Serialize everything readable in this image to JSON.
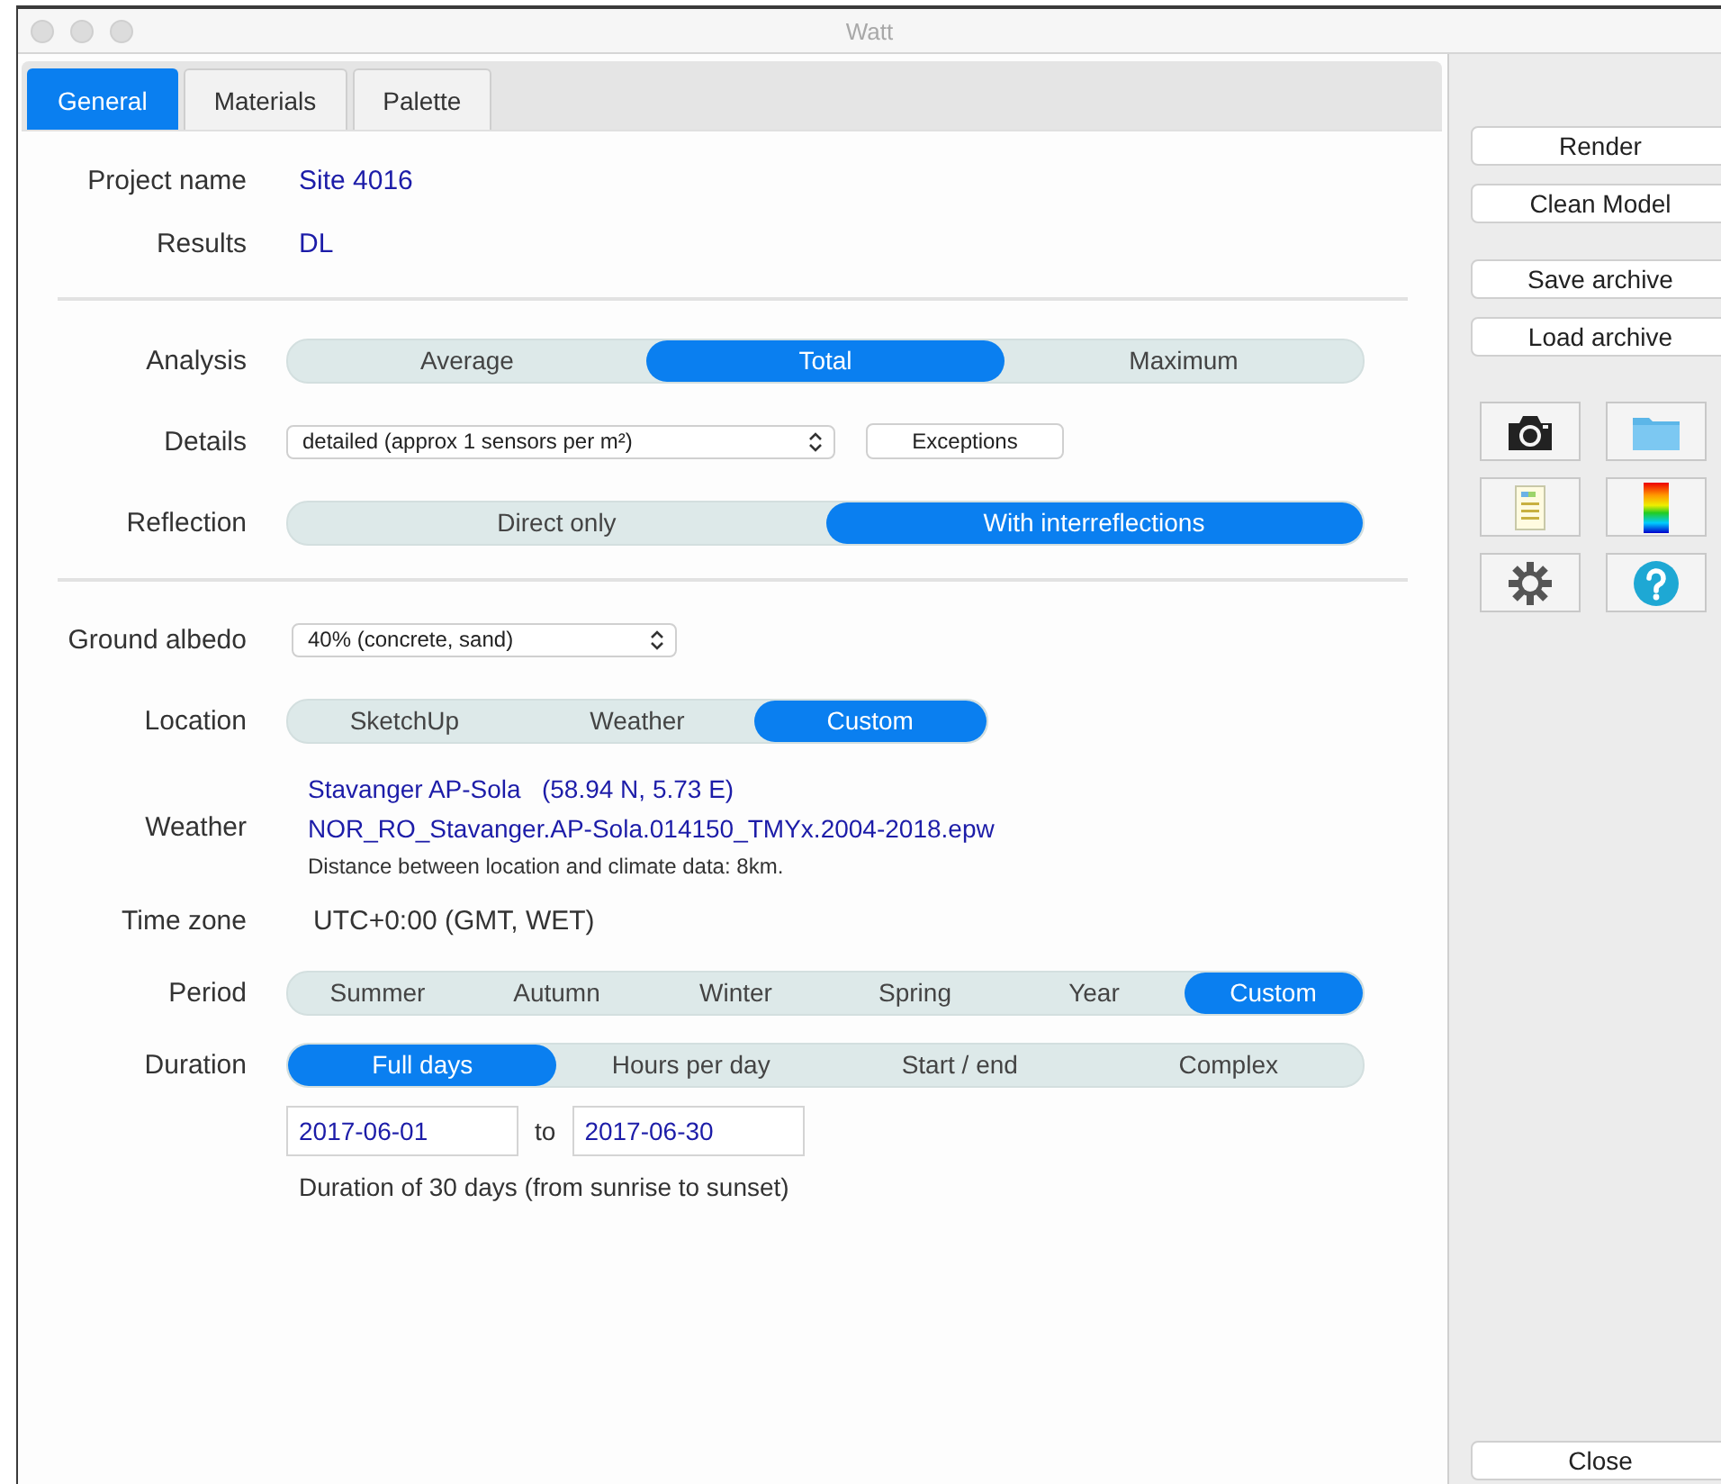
{
  "window": {
    "title": "Watt"
  },
  "tabs": [
    {
      "label": "General",
      "selected": true
    },
    {
      "label": "Materials",
      "selected": false
    },
    {
      "label": "Palette",
      "selected": false
    }
  ],
  "sections": [
    [
      {
        "kind": "value",
        "label": "Project name",
        "value": "Site 4016"
      },
      {
        "kind": "value",
        "label": "Results",
        "value": "DL"
      }
    ],
    [
      {
        "kind": "segmented",
        "label": "Analysis",
        "options": [
          {
            "label": "Average",
            "selected": false
          },
          {
            "label": "Total",
            "selected": true
          },
          {
            "label": "Maximum",
            "selected": false
          }
        ]
      },
      {
        "kind": "select",
        "label": "Details",
        "value": "detailed (approx 1 sensors per m²)",
        "button": "Exceptions"
      },
      {
        "kind": "segmented",
        "label": "Reflection",
        "options": [
          {
            "label": "Direct only",
            "selected": false
          },
          {
            "label": "With interreflections",
            "selected": true
          }
        ]
      }
    ],
    [
      {
        "kind": "select",
        "label": "Ground albedo",
        "value": "40% (concrete, sand)"
      },
      {
        "kind": "segmented",
        "label": "Location",
        "compact": true,
        "options": [
          {
            "label": "SketchUp",
            "selected": false
          },
          {
            "label": "Weather",
            "selected": false
          },
          {
            "label": "Custom",
            "selected": true
          }
        ]
      },
      {
        "kind": "weather",
        "label": "Weather",
        "station": "Stavanger AP-Sola",
        "coords": "(58.94 N, 5.73 E)",
        "file": "NOR_RO_Stavanger.AP-Sola.014150_TMYx.2004-2018.epw",
        "note": "Distance between location and climate data: 8km."
      },
      {
        "kind": "text",
        "label": "Time zone",
        "value": "UTC+0:00 (GMT, WET)"
      },
      {
        "kind": "segmented",
        "label": "Period",
        "options": [
          {
            "label": "Summer",
            "selected": false
          },
          {
            "label": "Autumn",
            "selected": false
          },
          {
            "label": "Winter",
            "selected": false
          },
          {
            "label": "Spring",
            "selected": false
          },
          {
            "label": "Year",
            "selected": false
          },
          {
            "label": "Custom",
            "selected": true
          }
        ]
      },
      {
        "kind": "segmented",
        "label": "Duration",
        "tight": true,
        "options": [
          {
            "label": "Full days",
            "selected": true
          },
          {
            "label": "Hours per day",
            "selected": false
          },
          {
            "label": "Start / end",
            "selected": false
          },
          {
            "label": "Complex",
            "selected": false
          }
        ]
      },
      {
        "kind": "dates",
        "from": "2017-06-01",
        "joiner": "to",
        "to": "2017-06-30",
        "note": "Duration of 30 days (from sunrise to sunset)"
      }
    ]
  ],
  "actions": [
    [
      "Render",
      "Clean Model"
    ],
    [
      "Save archive",
      "Load archive"
    ]
  ],
  "close_button": "Close"
}
